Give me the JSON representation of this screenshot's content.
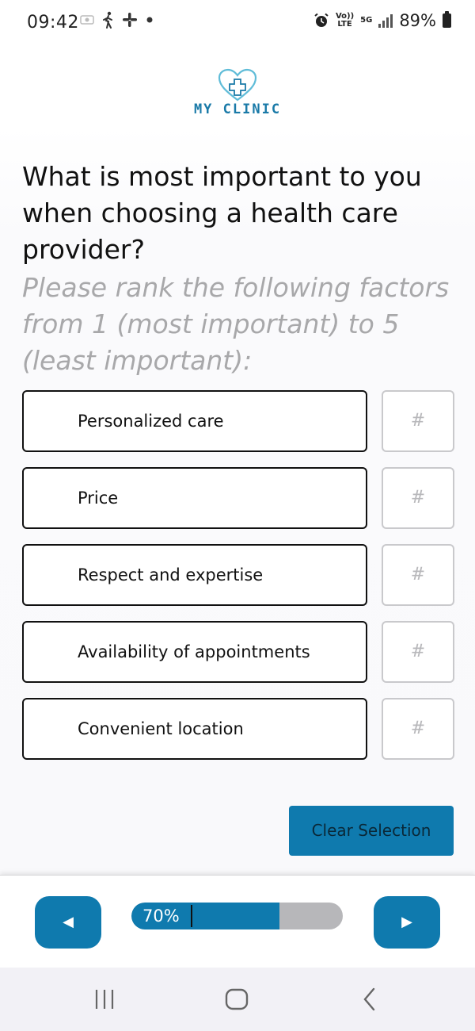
{
  "status_bar": {
    "time": "09:42",
    "battery": "89%",
    "volte_tag": "Vo))\nLTE",
    "network_tag": "5G",
    "colors": {
      "text": "#222222"
    }
  },
  "logo": {
    "text": "MY CLINIC",
    "color": "#1a7aa8",
    "icon": "heart-cross-icon"
  },
  "question": {
    "title": "What is most important to you when choosing a health care provider?",
    "instruction": "Please rank the following factors from 1 (most important) to 5 (least important):"
  },
  "options": [
    {
      "label": "Personalized care",
      "rank_placeholder": "#"
    },
    {
      "label": "Price",
      "rank_placeholder": "#"
    },
    {
      "label": "Respect and expertise",
      "rank_placeholder": "#"
    },
    {
      "label": "Availability of appointments",
      "rank_placeholder": "#"
    },
    {
      "label": "Convenient location",
      "rank_placeholder": "#"
    }
  ],
  "actions": {
    "clear_label": "Clear Selection"
  },
  "navigation": {
    "prev_label": "◀",
    "next_label": "▶",
    "progress_label": "70%",
    "progress_percent": 70
  },
  "theme": {
    "accent": "#0f7aae",
    "track": "#b7b7ba",
    "border": "#111111",
    "rank_border": "#c9c9cc",
    "muted_text": "#a8a8aa"
  }
}
